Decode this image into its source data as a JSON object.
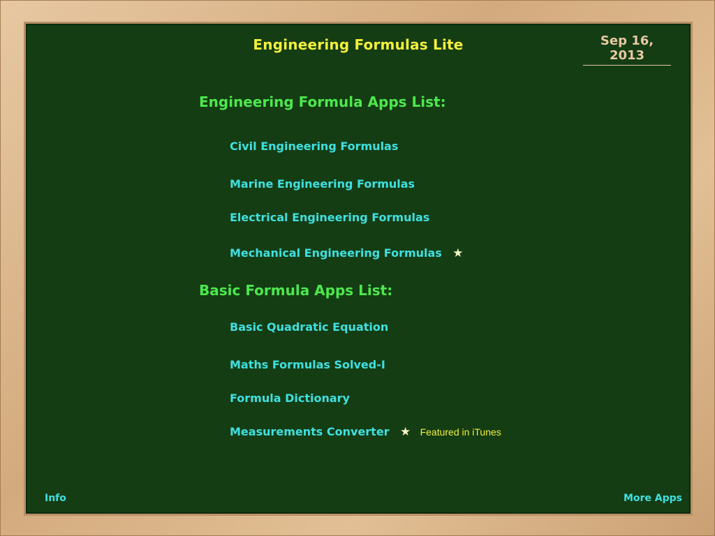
{
  "header": {
    "title": "Engineering Formulas Lite",
    "date": "Sep 16, 2013"
  },
  "sections": [
    {
      "title": "Engineering Formula Apps List:",
      "items": [
        {
          "label": "Civil Engineering Formulas"
        },
        {
          "label": "Marine Engineering Formulas"
        },
        {
          "label": "Electrical Engineering Formulas"
        },
        {
          "label": "Mechanical Engineering Formulas",
          "icon": "star-icon"
        }
      ]
    },
    {
      "title": "Basic Formula Apps List:",
      "items": [
        {
          "label": "Basic Quadratic Equation"
        },
        {
          "label": "Maths Formulas Solved-I"
        },
        {
          "label": "Formula Dictionary"
        },
        {
          "label": "Measurements Converter",
          "icon": "star-icon",
          "note": "Featured in iTunes"
        }
      ]
    }
  ],
  "footer": {
    "info_label": "Info",
    "more_label": "More Apps"
  },
  "colors": {
    "board": "#143d14",
    "title": "#f4f03c",
    "section": "#4de84d",
    "link": "#3fe0e0",
    "frame": "#d8b58e"
  }
}
